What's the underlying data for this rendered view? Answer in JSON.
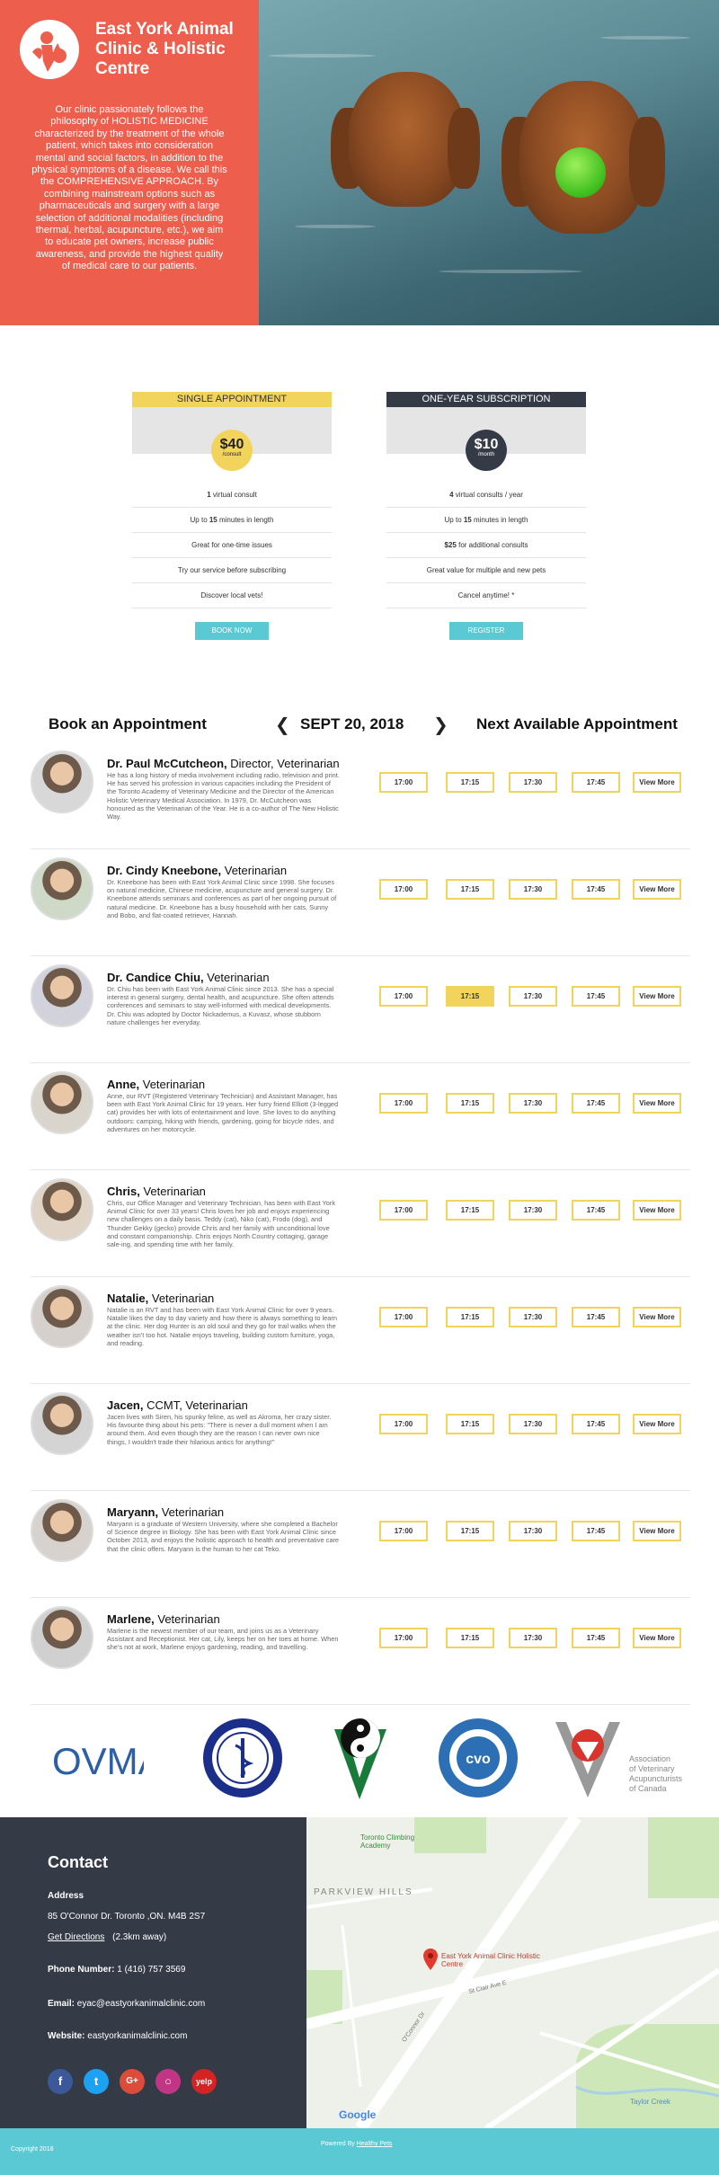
{
  "hero": {
    "clinic_name": "East York Animal Clinic & Holistic Centre",
    "description": "Our clinic passionately follows the philosophy of HOLISTIC MEDICINE characterized by the treatment of the whole patient, which takes into consideration mental and social factors, in addition to the physical symptoms of a disease. We call this the COMPREHENSIVE APPROACH. By combining mainstream options such as pharmaceuticals and surgery with a large selection of additional modalities (including thermal, herbal, acupuncture, etc.), we aim to educate pet owners, increase public awareness, and provide the highest quality of medical care to our patients.",
    "colors": {
      "brand": "#ee5e4c"
    }
  },
  "plans": [
    {
      "title": "SINGLE APPOINTMENT",
      "price": "$40",
      "unit": "/consult",
      "head_color": "#f2d35c",
      "features": [
        "1 virtual consult",
        "Up to 15 minutes in length",
        "Great for one-time issues",
        "Try our service before subscribing",
        "Discover local vets!"
      ],
      "button": "BOOK NOW"
    },
    {
      "title": "ONE-YEAR SUBSCRIPTION",
      "price": "$10",
      "unit": "/month",
      "head_color": "#343b47",
      "features": [
        "4 virtual consults / year",
        "Up to 15 minutes in length",
        "$25 for additional consults",
        "Great value for multiple and new pets",
        "Cancel anytime! *"
      ],
      "button": "REGISTER"
    }
  ],
  "booking": {
    "title": "Book an Appointment",
    "date": "SEPT 20, 2018",
    "next_available": "Next Available Appointment",
    "prev_icon": "chevron-left-icon",
    "next_icon": "chevron-right-icon",
    "slots": [
      "17:00",
      "17:15",
      "17:30",
      "17:45"
    ],
    "view_more": "View More"
  },
  "vets": [
    {
      "name": "Dr. Paul McCutcheon,",
      "role": " Director, Veterinarian",
      "bio": "He has a long history of media involvement including radio, television and print. He has served his profession in various capacities including the President of the Toronto Academy of Veterinary Medicine and the Director of the American Holistic Veterinary Medical Association. In 1979, Dr. McCutcheon was honoured as the Veterinarian of the Year. He is a co-author of The New Holistic Way."
    },
    {
      "name": "Dr. Cindy Kneebone,",
      "role": " Veterinarian",
      "bio": "Dr. Kneebone has been with East York Animal Clinic since 1998. She focuses on natural medicine, Chinese medicine, acupuncture and general surgery. Dr. Kneebone attends seminars and conferences as part of her ongoing pursuit of natural medicine. Dr. Kneebone has a busy household with her cats, Sunny and Bobo, and flat-coated retriever, Hannah."
    },
    {
      "name": "Dr. Candice Chiu,",
      "role": " Veterinarian",
      "bio": "Dr. Chiu has been with East York Animal Clinic since 2013. She has a special interest in general surgery, dental health, and acupuncture. She often attends conferences and seminars to stay well-informed with medical developments. Dr. Chiu was adopted by Doctor Nickademus, a Kuvasz, whose stubborn nature challenges her everyday.",
      "selected": "17:15"
    },
    {
      "name": "Anne,",
      "role": " Veterinarian",
      "bio": "Anne, our RVT (Registered Veterinary Technician) and Assistant Manager, has been with East York Animal Clinic for 19 years. Her furry friend Elliott (3-legged cat) provides her with lots of entertainment and love. She loves to do anything outdoors: camping, hiking with friends, gardening, going for bicycle rides, and adventures on her motorcycle."
    },
    {
      "name": "Chris,",
      "role": " Veterinarian",
      "bio": "Chris, our Office Manager and Veterinary Technician, has been with East York Animal Clinic for over 33 years! Chris loves her job and enjoys experiencing new challenges on a daily basis. Teddy (cat), Niko (cat), Frodo (dog), and Thunder Gekky (gecko) provide Chris and her family with unconditional love and constant companionship. Chris enjoys North Country cottaging, garage sale-ing, and spending time with her family."
    },
    {
      "name": "Natalie,",
      "role": " Veterinarian",
      "bio": "Natalie is an RVT and has been with East York Animal Clinic for over 9 years. Natalie likes the day to day variety and how there is always something to learn at the clinic. Her dog Hunter is an old soul and they go for trail walks when the weather isn't too hot. Natalie enjoys traveling, building custom furniture, yoga, and reading."
    },
    {
      "name": "Jacen,",
      "role": " CCMT, Veterinarian",
      "bio": "Jacen lives with Siren, his spunky feline, as well as Akroma, her crazy sister. His favourite thing about his pets: \"There is never a dull moment when I am around them. And even though they are the reason I can never own nice things, I wouldn't trade their hilarious antics for anything!\""
    },
    {
      "name": "Maryann,",
      "role": " Veterinarian",
      "bio": "Maryann is a graduate of Western University, where she completed a Bachelor of Science degree in Biology. She has been with East York Animal Clinic since October 2013, and enjoys the holistic approach to health and preventative care that the clinic offers. Maryann is the human to her cat Teko."
    },
    {
      "name": "Marlene,",
      "role": " Veterinarian",
      "bio": "Marlene is the newest member of our team, and joins us as a Veterinary Assistant and Receptionist. Her cat, Lily, keeps her on her toes at home. When she's not at work, Marlene enjoys gardening, reading, and travelling."
    }
  ],
  "logos": {
    "omva": "OVMA",
    "aava_lines": [
      "Association",
      "of Veterinary",
      "Acupuncturists",
      "of Canada"
    ]
  },
  "contact": {
    "title": "Contact",
    "address_label": "Address",
    "address": "85 O'Connor Dr. Toronto ,ON. M4B 2S7",
    "directions": "Get Directions",
    "distance": "(2.3km away)",
    "phone_label": "Phone Number:",
    "phone": "1 (416) 757 3569",
    "email_label": "Email:",
    "email": "eyac@eastyorkanimalclinic.com",
    "website_label": "Website:",
    "website": "eastyorkanimalclinic.com",
    "social": [
      "facebook-icon",
      "twitter-icon",
      "google-plus-icon",
      "instagram-icon",
      "yelp-icon"
    ]
  },
  "map": {
    "place1": "Toronto Climbing Academy",
    "area": "PARKVIEW HILLS",
    "marker_label": "East York Animal Clinic Holistic Centre",
    "street1": "O'Connor Dr",
    "street2": "St Clair Ave E",
    "creek": "Taylor Creek",
    "brand": "Google"
  },
  "footer": {
    "copyright": "Copyright 2018",
    "powered": "Powered By",
    "powered_link": "Healthy Pets"
  }
}
